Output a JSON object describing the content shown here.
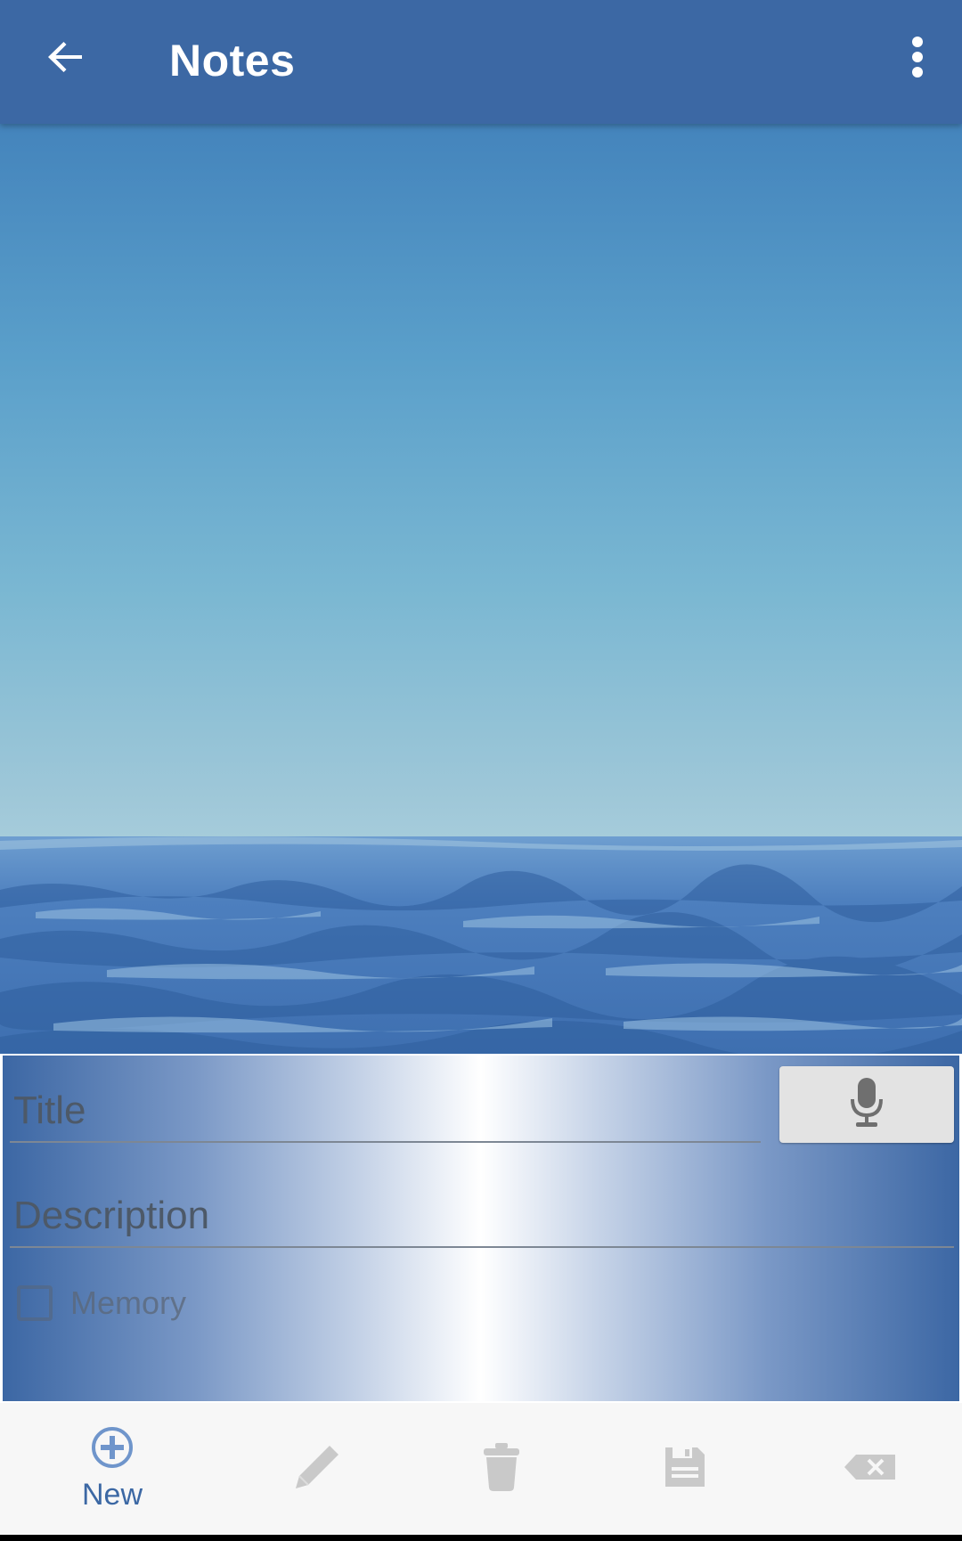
{
  "app_bar": {
    "title": "Notes",
    "background_color": "#3c68a4",
    "back_icon": "arrow-back-icon",
    "menu_icon": "more-vert-icon"
  },
  "hero_image": {
    "subject": "ocean waves under a clear blue sky"
  },
  "form": {
    "title_placeholder": "Title",
    "title_value": "",
    "description_placeholder": "Description",
    "description_value": "",
    "mic_icon": "microphone-icon",
    "memory_label": "Memory",
    "memory_checked": false
  },
  "bottom_bar": {
    "items": [
      {
        "label": "New",
        "icon": "add-circle-icon",
        "enabled": true
      },
      {
        "label": "",
        "icon": "pencil-icon",
        "enabled": false
      },
      {
        "label": "",
        "icon": "trash-icon",
        "enabled": false
      },
      {
        "label": "",
        "icon": "save-icon",
        "enabled": false
      },
      {
        "label": "",
        "icon": "backspace-icon",
        "enabled": false
      }
    ]
  },
  "colors": {
    "accent": "#3c68a4",
    "disabled_icon": "#c9c9c9",
    "toolbar_bg": "#f7f7f7"
  }
}
